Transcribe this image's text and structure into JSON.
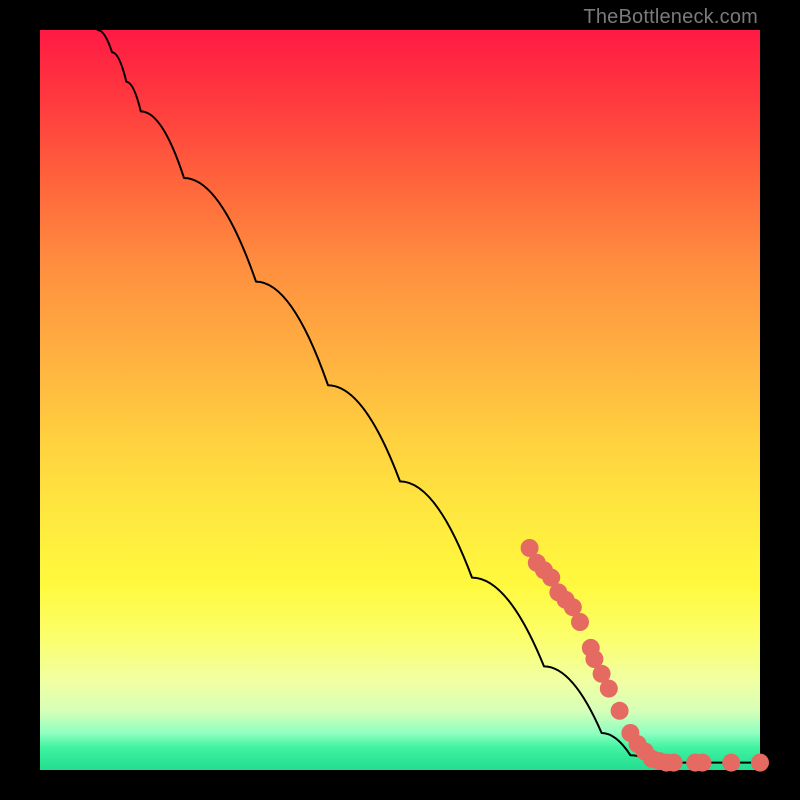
{
  "watermark": "TheBottleneck.com",
  "chart_data": {
    "type": "line",
    "title": "",
    "xlabel": "",
    "ylabel": "",
    "xlim": [
      0,
      100
    ],
    "ylim": [
      0,
      100
    ],
    "grid": false,
    "legend": false,
    "curve": [
      {
        "x": 8,
        "y": 100
      },
      {
        "x": 10,
        "y": 97
      },
      {
        "x": 12,
        "y": 93
      },
      {
        "x": 14,
        "y": 89
      },
      {
        "x": 20,
        "y": 80
      },
      {
        "x": 30,
        "y": 66
      },
      {
        "x": 40,
        "y": 52
      },
      {
        "x": 50,
        "y": 39
      },
      {
        "x": 60,
        "y": 26
      },
      {
        "x": 70,
        "y": 14
      },
      {
        "x": 78,
        "y": 5
      },
      {
        "x": 82,
        "y": 2
      },
      {
        "x": 85,
        "y": 1
      },
      {
        "x": 90,
        "y": 1
      },
      {
        "x": 95,
        "y": 1
      },
      {
        "x": 100,
        "y": 1
      }
    ],
    "markers": [
      {
        "x": 68,
        "y": 30
      },
      {
        "x": 69,
        "y": 28
      },
      {
        "x": 70,
        "y": 27
      },
      {
        "x": 71,
        "y": 26
      },
      {
        "x": 72,
        "y": 24
      },
      {
        "x": 73,
        "y": 23
      },
      {
        "x": 74,
        "y": 22
      },
      {
        "x": 75,
        "y": 20
      },
      {
        "x": 76.5,
        "y": 16.5
      },
      {
        "x": 77,
        "y": 15
      },
      {
        "x": 78,
        "y": 13
      },
      {
        "x": 79,
        "y": 11
      },
      {
        "x": 80.5,
        "y": 8
      },
      {
        "x": 82,
        "y": 5
      },
      {
        "x": 83,
        "y": 3.5
      },
      {
        "x": 84,
        "y": 2.5
      },
      {
        "x": 85,
        "y": 1.5
      },
      {
        "x": 86,
        "y": 1.2
      },
      {
        "x": 87,
        "y": 1
      },
      {
        "x": 88,
        "y": 1
      },
      {
        "x": 91,
        "y": 1
      },
      {
        "x": 92,
        "y": 1
      },
      {
        "x": 96,
        "y": 1
      },
      {
        "x": 100,
        "y": 1
      }
    ],
    "marker_color": "#e46a62",
    "line_color": "#000000"
  }
}
